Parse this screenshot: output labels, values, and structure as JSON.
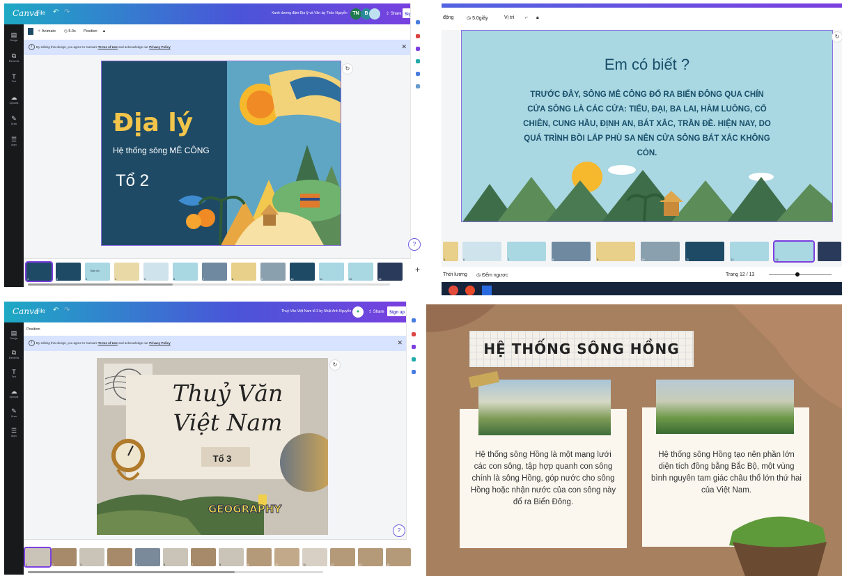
{
  "panel1": {
    "app_logo": "Canva",
    "menu_file": "File",
    "doc_title": "Xanh dương đậm Địa lý và Văn ...",
    "author": "by Thảo Nguyễn",
    "avatars": [
      "TN",
      "B"
    ],
    "share": "Share",
    "signup": "Sign up",
    "left_rail": [
      "Design",
      "Elements",
      "Text",
      "Uploads",
      "Draw",
      "Apps"
    ],
    "toolbar": {
      "animate": "Animate",
      "duration": "5.0s",
      "position": "Position"
    },
    "notice": {
      "prefix": "By editing this design, you agree to Canva's",
      "terms": "Terms of Use",
      "middle": "and acknowledge our",
      "privacy": "Privacy Policy"
    },
    "slide": {
      "title": "Địa lý",
      "subtitle": "Hệ thống sông MÊ CÔNG",
      "group": "Tổ 2"
    },
    "thumbnails": [
      "1",
      "2",
      "3",
      "4",
      "5",
      "6",
      "7",
      "8",
      "9",
      "10",
      "11",
      "12",
      "13"
    ],
    "thumb_text": {
      "t3": "Bản đồ"
    }
  },
  "panel2": {
    "toolbar": {
      "item1": "động",
      "duration": "5.0giây",
      "position": "Vị trí"
    },
    "slide": {
      "title": "Em có biết ?",
      "body": "TRƯỚC ĐÂY, SÔNG MÊ CÔNG ĐỔ RA BIỂN ĐÔNG QUA CHÍN CỬA SÔNG LÀ CÁC CỬA: TIỂU, ĐẠI, BA LAI, HÀM LUÔNG, CỔ CHIÊN, CUNG HẦU, ĐỊNH AN, BÁT XẮC, TRẦN ĐỀ. HIỆN NAY, DO QUÁ TRÌNH BỒI LẮP PHÙ SA NÊN CỬA SÔNG BÁT XẮC KHÔNG CÒN."
    },
    "thumbnails": [
      "5",
      "6",
      "7",
      "8",
      "9",
      "10",
      "11",
      "12",
      "13"
    ],
    "footer": {
      "duration": "Thời lượng",
      "timer": "Đếm ngược",
      "page": "Trang 12 / 13"
    }
  },
  "panel3": {
    "app_logo": "Canva",
    "menu_file": "File",
    "doc_title": "Thuỷ Văn Việt Nam tổ 3 by Nhật Anh Nguyễn",
    "share": "Share",
    "signup": "Sign up",
    "left_rail": [
      "Design",
      "Elements",
      "Text",
      "Uploads",
      "Draw",
      "Apps"
    ],
    "toolbar": {
      "position": "Position"
    },
    "notice": {
      "prefix": "By editing this design, you agree to Canva's",
      "terms": "Terms of Use",
      "middle": "and acknowledge our",
      "privacy": "Privacy Policy"
    },
    "slide": {
      "title_line1": "Thuỷ Văn",
      "title_line2": "Việt Nam",
      "group": "Tổ 3",
      "sticker": "GEOGRAPHY"
    },
    "thumbnails": [
      "1",
      "2",
      "3",
      "4",
      "5",
      "6",
      "7",
      "8",
      "9",
      "10",
      "11",
      "12",
      "13",
      "14"
    ]
  },
  "panel4": {
    "slide": {
      "title": "HỆ THỐNG SÔNG HỒNG",
      "left_text": "Hệ thống sông Hồng là một mạng lưới các con sông, tập hợp quanh con sông chính là sông Hồng, góp nước cho sông Hồng hoặc nhận nước của con sông này đổ ra Biển Đông.",
      "right_text": "Hệ thống sông Hồng tạo nên phần lớn diện tích đồng bằng Bắc Bộ, một vùng bình nguyên tam giác châu thổ lớn thứ hai của Việt Nam."
    }
  },
  "colors": {
    "canva_purple": "#7b3fe0",
    "canva_teal": "#1ea9c4",
    "slide1_bg": "#1e4a66",
    "slide1_title": "#f2c54a",
    "slide2_bg": "#a9d7e2",
    "slide2_text": "#184f6a",
    "slide4_bg": "#a7805f"
  },
  "icons": [
    "undo-icon",
    "redo-icon",
    "share-icon",
    "refresh-icon",
    "help-icon",
    "close-icon",
    "clock-icon",
    "paint-roller-icon",
    "lock-icon",
    "info-icon"
  ]
}
